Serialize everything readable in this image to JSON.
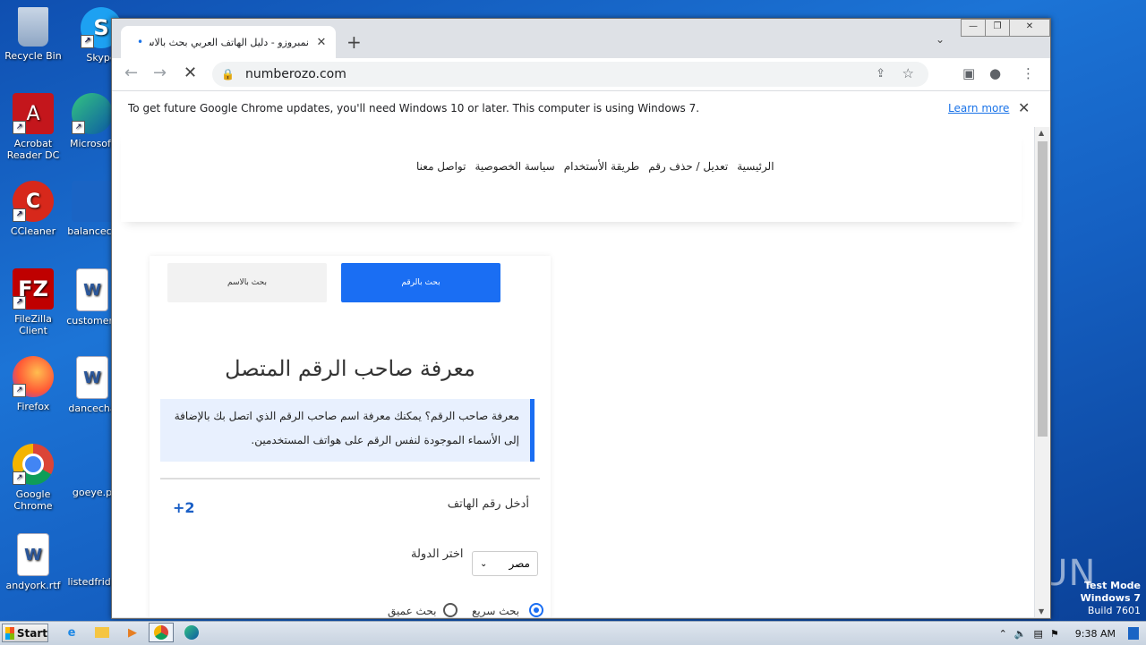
{
  "desktop": {
    "icons": [
      {
        "label": "Recycle Bin",
        "icon": "recycle-bin-icon"
      },
      {
        "label": "Skype",
        "icon": "skype-icon"
      },
      {
        "label": "Acrobat Reader DC",
        "icon": "acrobat-icon"
      },
      {
        "label": "Microsoft",
        "icon": "edge-icon"
      },
      {
        "label": "CCleaner",
        "icon": "ccleaner-icon"
      },
      {
        "label": "balancecc",
        "icon": "folder-icon"
      },
      {
        "label": "FileZilla Client",
        "icon": "filezilla-icon"
      },
      {
        "label": "customerc",
        "icon": "word-doc-icon"
      },
      {
        "label": "Firefox",
        "icon": "firefox-icon"
      },
      {
        "label": "dancecha",
        "icon": "word-doc-icon"
      },
      {
        "label": "Google Chrome",
        "icon": "chrome-icon"
      },
      {
        "label": "goeye.p",
        "icon": "file-icon"
      },
      {
        "label": "andyork.rtf",
        "icon": "word-doc-icon"
      },
      {
        "label": "listedfrida",
        "icon": "file-icon"
      }
    ]
  },
  "browser": {
    "tab_title": "نمبروزو - دليل الهاتف العربي بحث بالاسم",
    "url": "numberozo.com",
    "infobar_message": "To get future Google Chrome updates, you'll need Windows 10 or later. This computer is using Windows 7.",
    "infobar_link": "Learn more"
  },
  "site": {
    "nav": [
      "الرئيسية",
      "تعديل / حذف رقم",
      "طريقة الأستخدام",
      "سياسة الخصوصية",
      "تواصل معنا"
    ],
    "tab_by_name": "بحث بالاسم",
    "tab_by_number": "بحث بالرقم",
    "heading": "معرفة صاحب الرقم المتصل",
    "info_text": "معرفة صاحب الرقم؟ يمكنك معرفة اسم صاحب الرقم الذي اتصل بك بالإضافة إلى الأسماء الموجودة لنفس الرقم على هواتف المستخدمين.",
    "phone_label": "أدخل رقم الهاتف",
    "country_code": "+2",
    "country_label": "اختر الدولة",
    "country_value": "مصر",
    "radio_quick": "بحث سريع",
    "radio_deep": "بحث عميق"
  },
  "taskbar": {
    "start": "Start",
    "clock": "9:38 AM"
  },
  "watermark": "ANY RUN",
  "os_notice": {
    "line1": "Test Mode",
    "line2": "Windows 7",
    "line3": "Build 7601"
  }
}
